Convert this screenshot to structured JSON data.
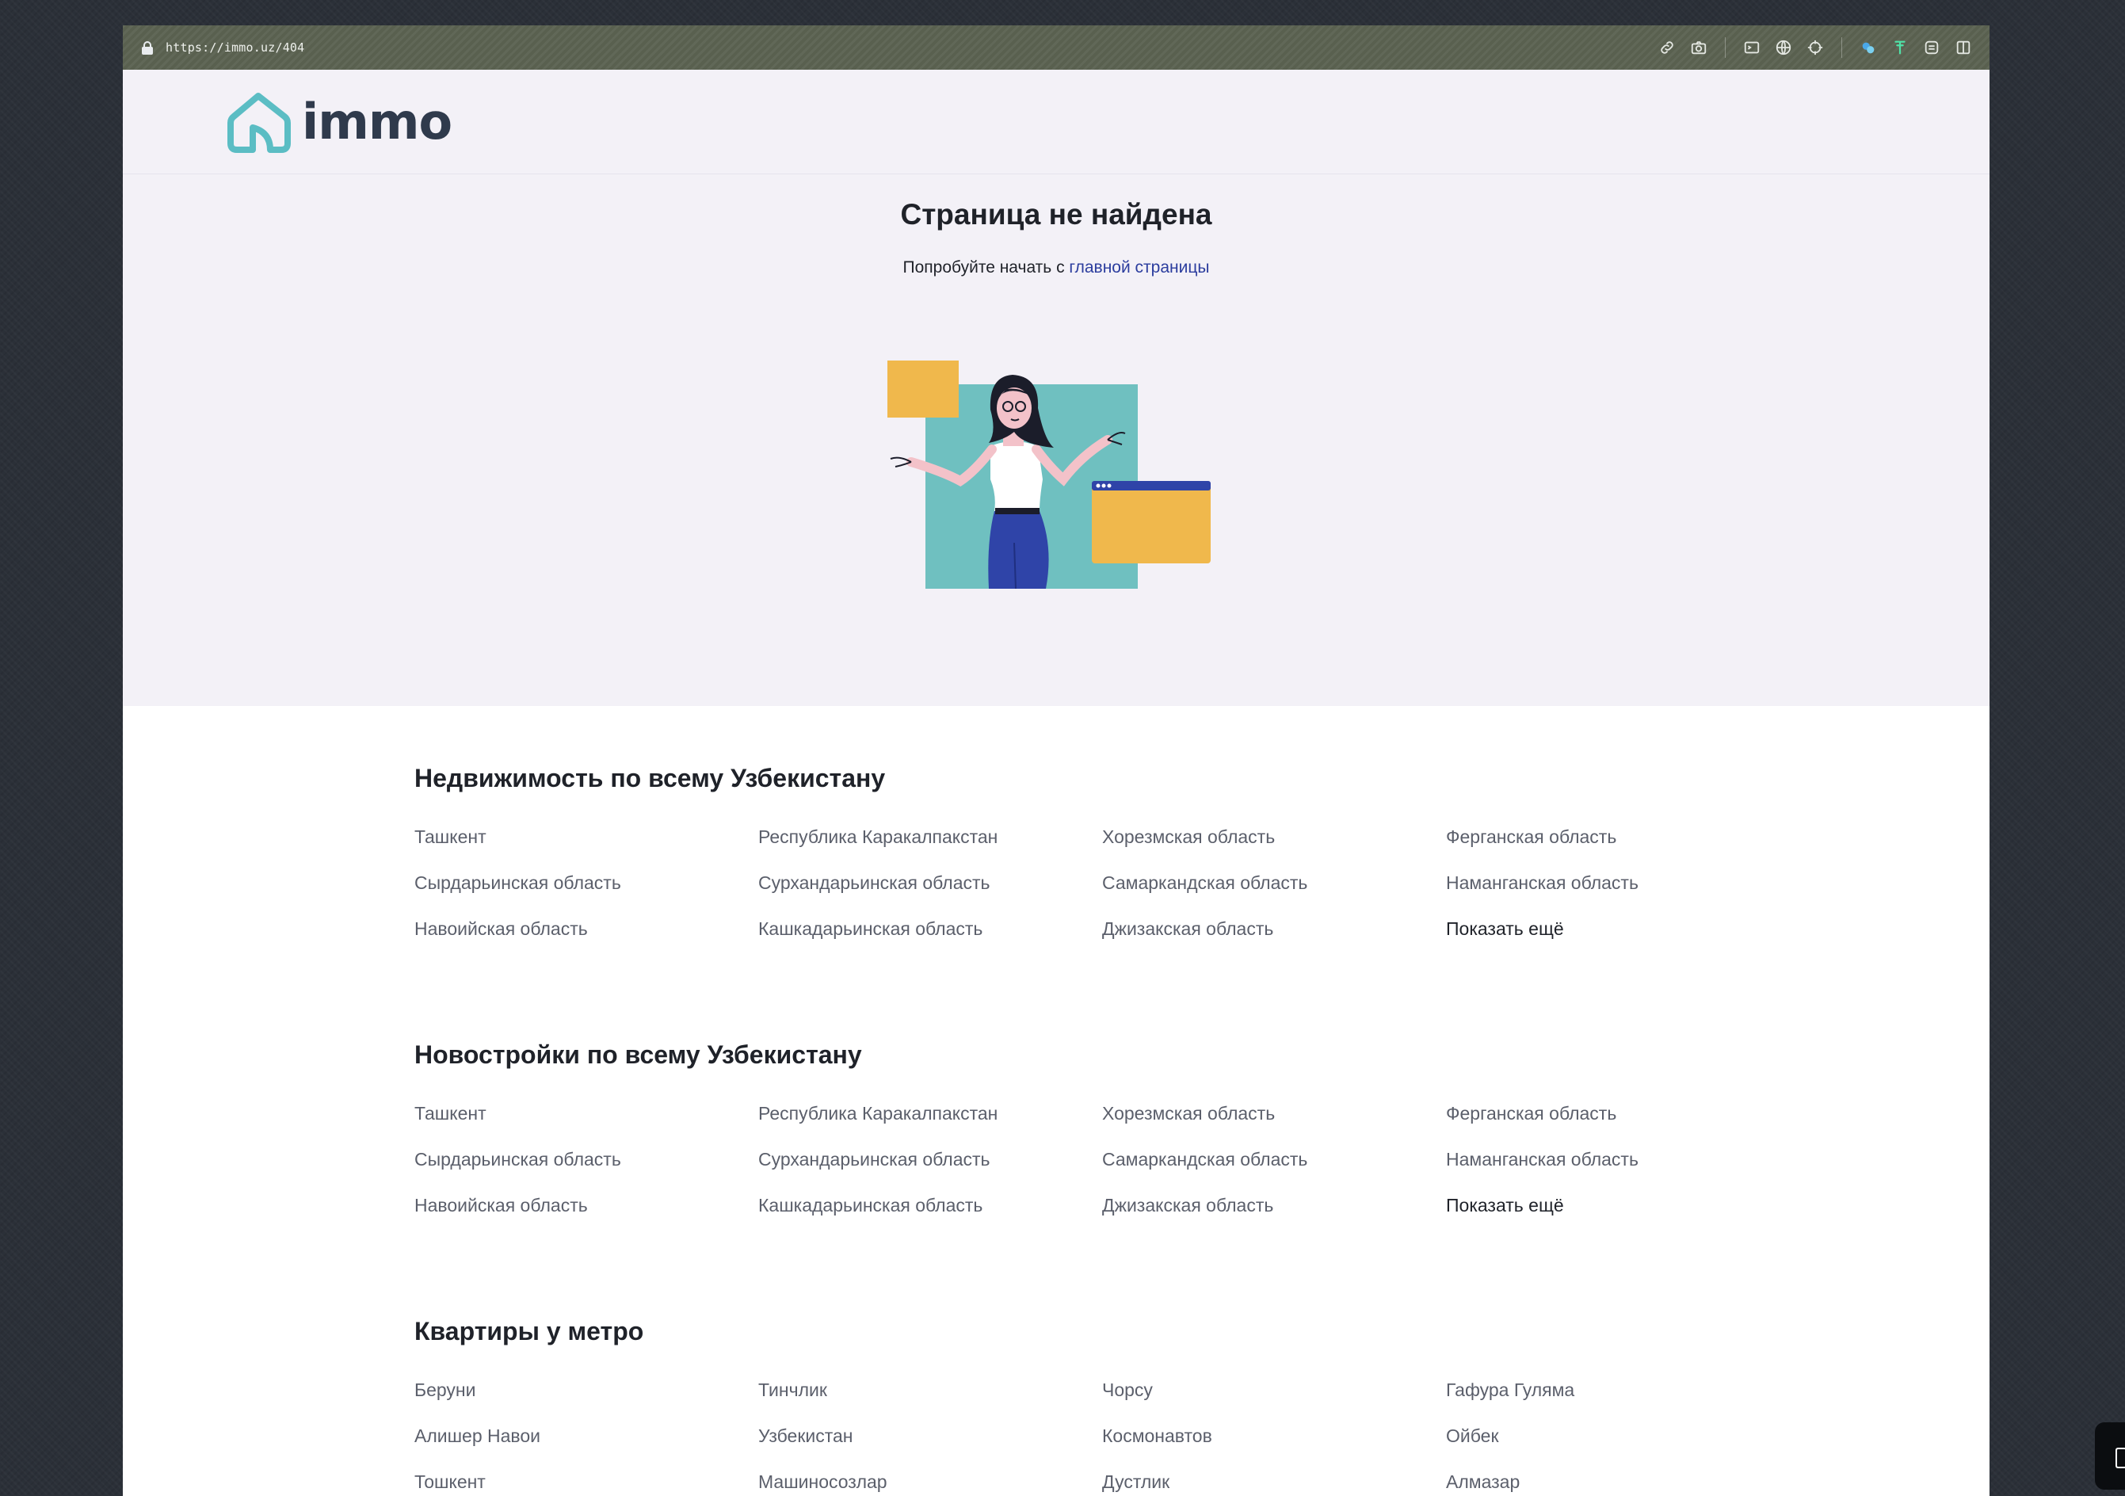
{
  "browser": {
    "url": "https://immo.uz/404"
  },
  "site": {
    "logo_text": "immo"
  },
  "hero": {
    "title": "Страница не найдена",
    "subtitle_prefix": "Попробуйте начать с ",
    "subtitle_link": "главной страницы"
  },
  "sections": [
    {
      "title": "Недвижимость по всему Узбекистану",
      "links": [
        "Ташкент",
        "Республика Каракалпакстан",
        "Хорезмская область",
        "Ферганская область",
        "Сырдарьинская область",
        "Сурхандарьинская область",
        "Самаркандская область",
        "Наманганская область",
        "Навоийская область",
        "Кашкадарьинская область",
        "Джизакская область"
      ],
      "more": "Показать ещё"
    },
    {
      "title": "Новостройки по всему Узбекистану",
      "links": [
        "Ташкент",
        "Республика Каракалпакстан",
        "Хорезмская область",
        "Ферганская область",
        "Сырдарьинская область",
        "Сурхандарьинская область",
        "Самаркандская область",
        "Наманганская область",
        "Навоийская область",
        "Кашкадарьинская область",
        "Джизакская область"
      ],
      "more": "Показать ещё"
    },
    {
      "title": "Квартиры у метро",
      "links": [
        "Беруни",
        "Тинчлик",
        "Чорсу",
        "Гафура Гуляма",
        "Алишер Навои",
        "Узбекистан",
        "Космонавтов",
        "Ойбек",
        "Тошкент",
        "Машиносозлар",
        "Дустлик",
        "Алмазар"
      ]
    }
  ],
  "colors": {
    "brand_teal": "#5bbdc4",
    "link_blue": "#2b3d9e",
    "hero_bg": "#f3f1f7",
    "illus_teal": "#6fc0c0",
    "illus_yellow": "#f0b84c",
    "illus_blue": "#2f44a8"
  },
  "icons": [
    "lock-icon",
    "link-icon",
    "camera-icon",
    "terminal-icon",
    "globe-icon",
    "crosshair-icon",
    "extension-icon",
    "pin-icon",
    "editor-icon",
    "split-view-icon"
  ]
}
